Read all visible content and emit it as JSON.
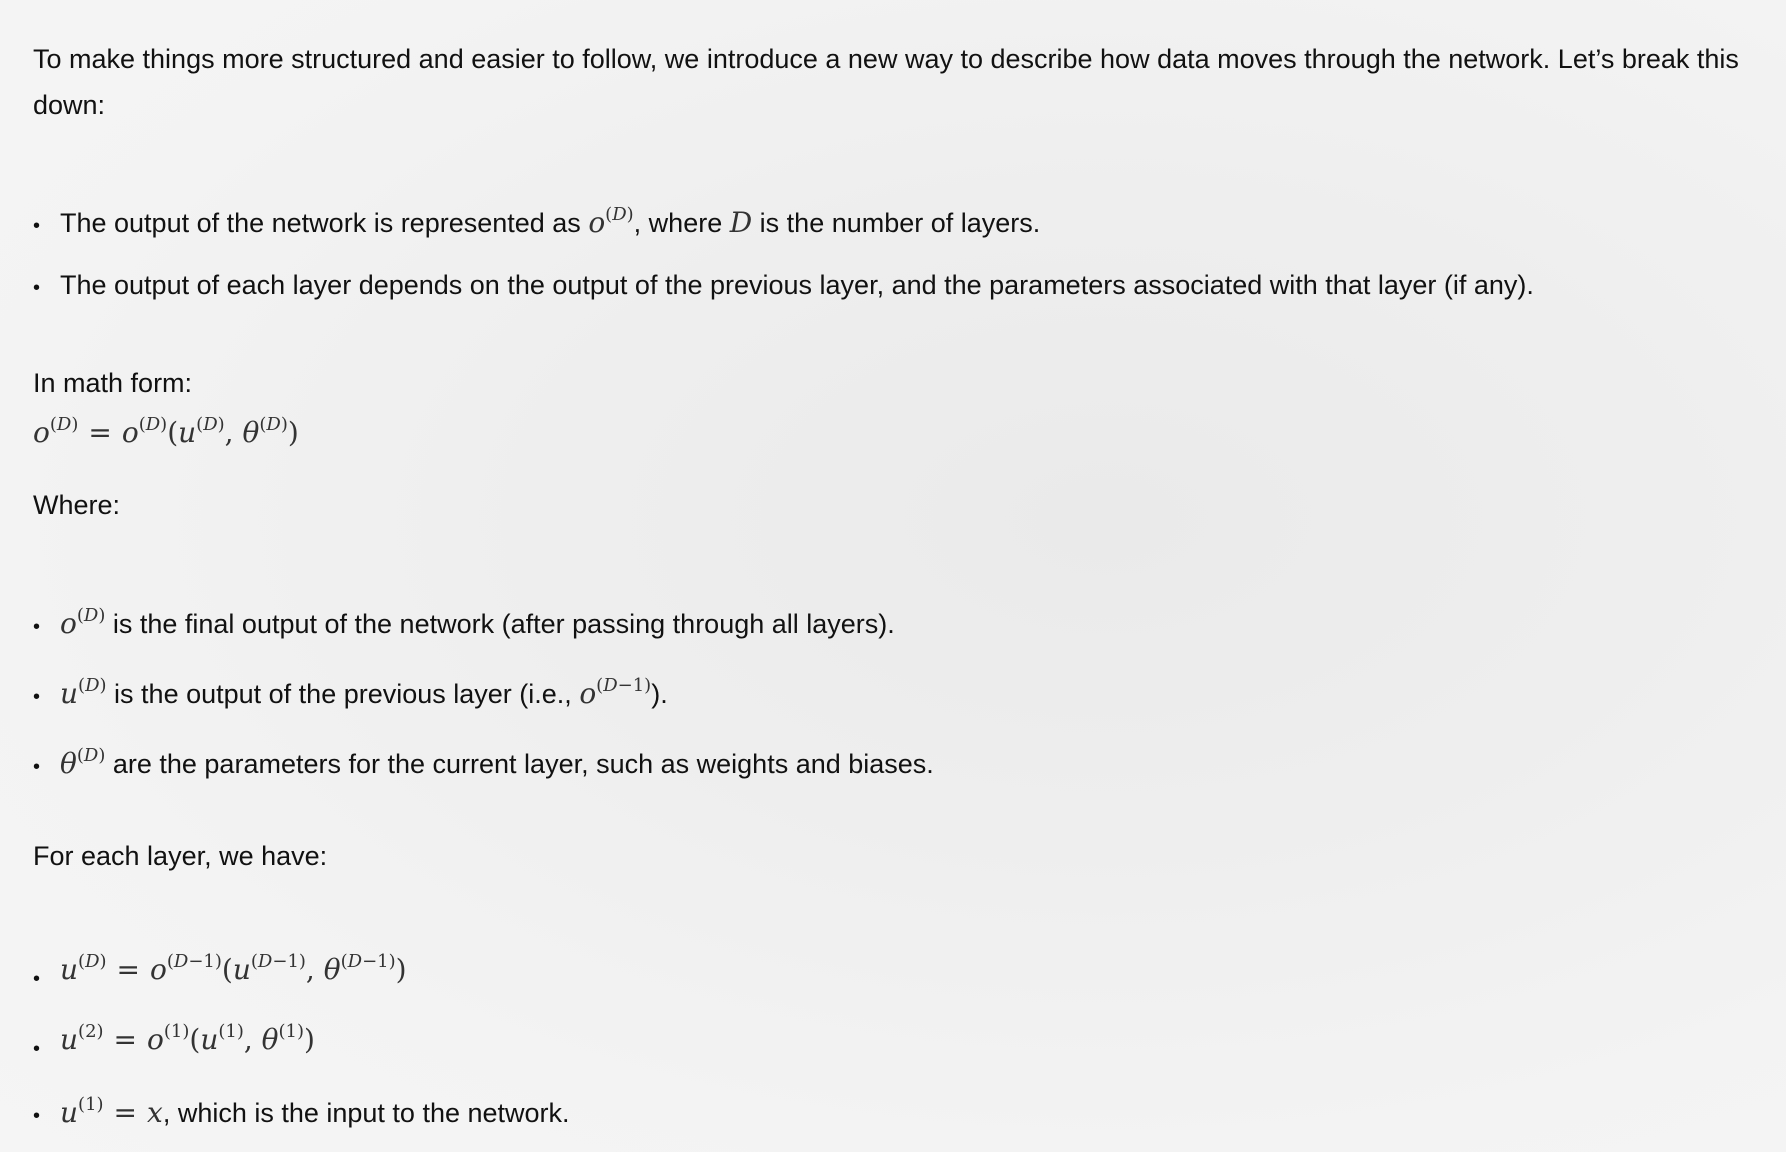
{
  "intro": "To make things more structured and easier to follow, we introduce a new way to describe how data moves through the network. Let’s break this down:",
  "bullets_1": [
    {
      "pre": "The output of the network is represented as ",
      "mid": ", where ",
      "post": " is the number of layers."
    },
    {
      "text": "The output of each layer depends on the output of the previous layer, and the parameters associated with that layer (if any)."
    }
  ],
  "math_form_label": "In math form:",
  "where_label": "Where:",
  "bullets_2": [
    {
      "text": " is the final output of the network (after passing through all layers)."
    },
    {
      "pre": " is the output of the previous layer (i.e., ",
      "post": ")."
    },
    {
      "text": " are the parameters for the current layer, such as weights and biases."
    }
  ],
  "for_each_label": "For each layer, we have:",
  "bullets_3_tail": ", which is the input to the network."
}
